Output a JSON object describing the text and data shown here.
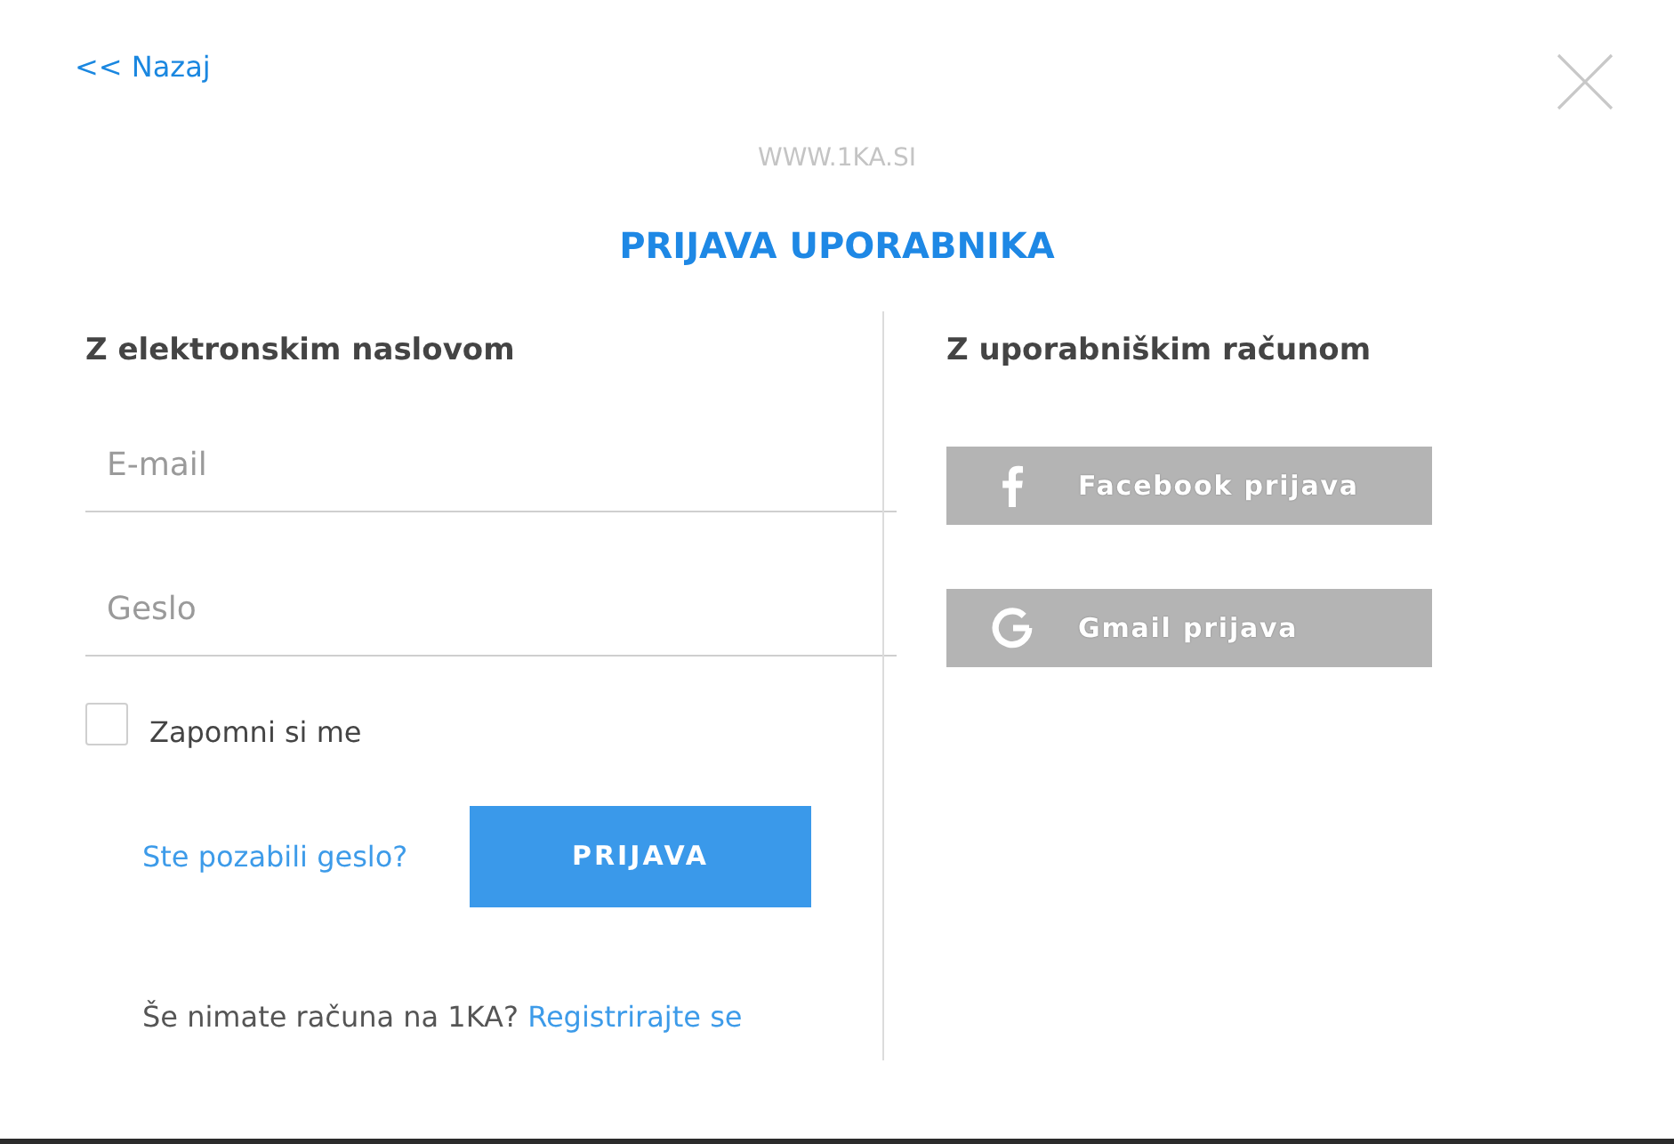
{
  "back_link": "<< Nazaj",
  "site": "WWW.1KA.SI",
  "title": "PRIJAVA UPORABNIKA",
  "email_login": {
    "heading": "Z elektronskim naslovom",
    "email_field": {
      "placeholder": "E-mail"
    },
    "password_field": {
      "placeholder": "Geslo"
    },
    "remember": {
      "label": "Zapomni si me",
      "checked": false
    },
    "forgot_link": "Ste pozabili geslo?",
    "submit": "PRIJAVA",
    "register": {
      "text": "Še nimate računa na 1KA?",
      "link": "Registrirajte se"
    }
  },
  "account_login": {
    "heading": "Z uporabniškim računom",
    "buttons": [
      {
        "kind": "facebook",
        "label": "Facebook prijava"
      },
      {
        "kind": "google",
        "label": "Gmail prijava"
      }
    ]
  }
}
